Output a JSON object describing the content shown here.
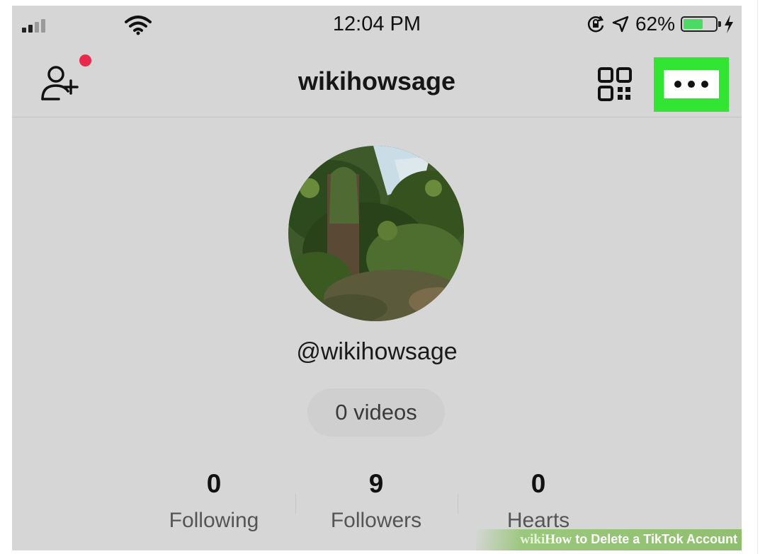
{
  "status_bar": {
    "time": "12:04 PM",
    "battery_percent": "62%",
    "battery_level": 0.62,
    "icons": [
      "signal-icon",
      "wifi-icon",
      "orientation-lock-icon",
      "location-icon",
      "battery-icon",
      "charging-icon"
    ]
  },
  "header": {
    "title": "wikihowsage",
    "left_icon": "add-user-icon",
    "right_icons": [
      "qr-code-icon",
      "more-options-icon"
    ],
    "highlight_color": "#33e533",
    "notification_dot_color": "#e8294c"
  },
  "profile": {
    "handle": "@wikihowsage",
    "videos_label": "0 videos"
  },
  "stats": [
    {
      "value": "0",
      "label": "Following"
    },
    {
      "value": "9",
      "label": "Followers"
    },
    {
      "value": "0",
      "label": "Hearts"
    }
  ],
  "watermark": {
    "brand": "wikiHow",
    "text": "wikiHow to Delete a TikTok Account",
    "prefix": "wiki",
    "suffix": "How",
    "rest": " to Delete a TikTok Account"
  },
  "colors": {
    "background": "#d6d6d6",
    "accent_green": "#33e533",
    "battery_green": "#4cd964"
  }
}
